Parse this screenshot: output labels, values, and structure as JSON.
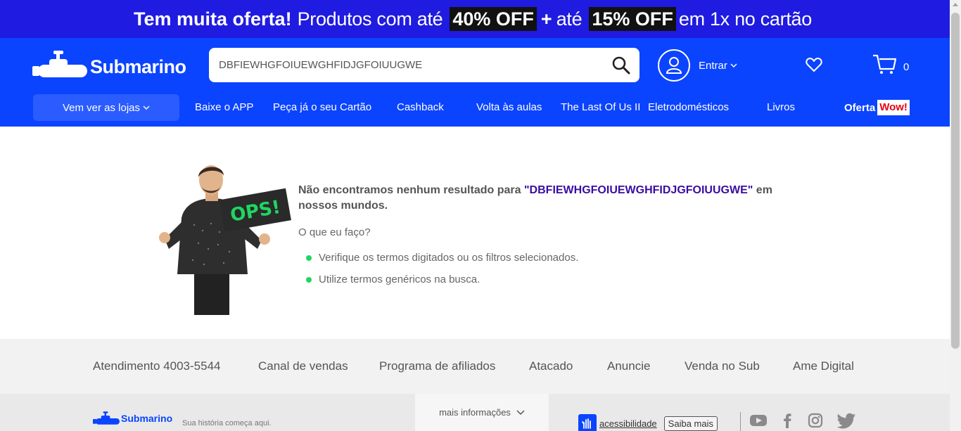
{
  "promo": {
    "bold": "Tem muita oferta!",
    "text1": "Produtos com até",
    "box1": "40% OFF",
    "plus": "+",
    "text2": "até",
    "box2": "15% OFF",
    "text3": "em 1x no cartão"
  },
  "header": {
    "logo": "Submarino",
    "search_value": "DBFIEWHGFOIUEWGHFIDJGFOIUUGWE",
    "account_label": "Entrar",
    "cart_count": "0",
    "icons": [
      "submarine-icon",
      "search-icon",
      "user-icon",
      "chevron-down-icon",
      "heart-icon",
      "cart-icon"
    ]
  },
  "nav": {
    "stores": "Vem ver as lojas",
    "items": [
      "Baixe o APP",
      "Peça já o seu Cartão",
      "Cashback",
      "Volta às aulas",
      "The Last Of Us II",
      "Eletrodomésticos",
      "Livros"
    ],
    "oferta": "Oferta",
    "wow": "Wow!"
  },
  "illustration": {
    "sign": "OPS!"
  },
  "main": {
    "title_prefix": "Não encontramos nenhum resultado para",
    "query": "\"DBFIEWHGFOIUEWGHFIDJGFOIUUGWE\"",
    "title_suffix": "em nossos mundos.",
    "subtitle": "O que eu faço?",
    "tips": [
      "Verifique os termos digitados ou os filtros selecionados.",
      "Utilize termos genéricos na busca."
    ]
  },
  "footer_links": [
    "Atendimento 4003-5544",
    "Canal de vendas",
    "Programa de afiliados",
    "Atacado",
    "Anuncie",
    "Venda no Sub",
    "Ame Digital"
  ],
  "footer_bottom": {
    "logo": "Submarino",
    "tagline": "Sua história começa aqui.",
    "more_info": "mais informações",
    "accessibility": "acessibilidade",
    "saiba_mais": "Saiba mais",
    "social_icons": [
      "youtube-icon",
      "facebook-icon",
      "instagram-icon",
      "twitter-icon"
    ]
  },
  "colors": {
    "promo_bg": "#1f1be0",
    "header_bg": "#0b44ff",
    "query_color": "#3a0ca3",
    "bullet": "#1ed760",
    "wow_red": "#e60014"
  }
}
